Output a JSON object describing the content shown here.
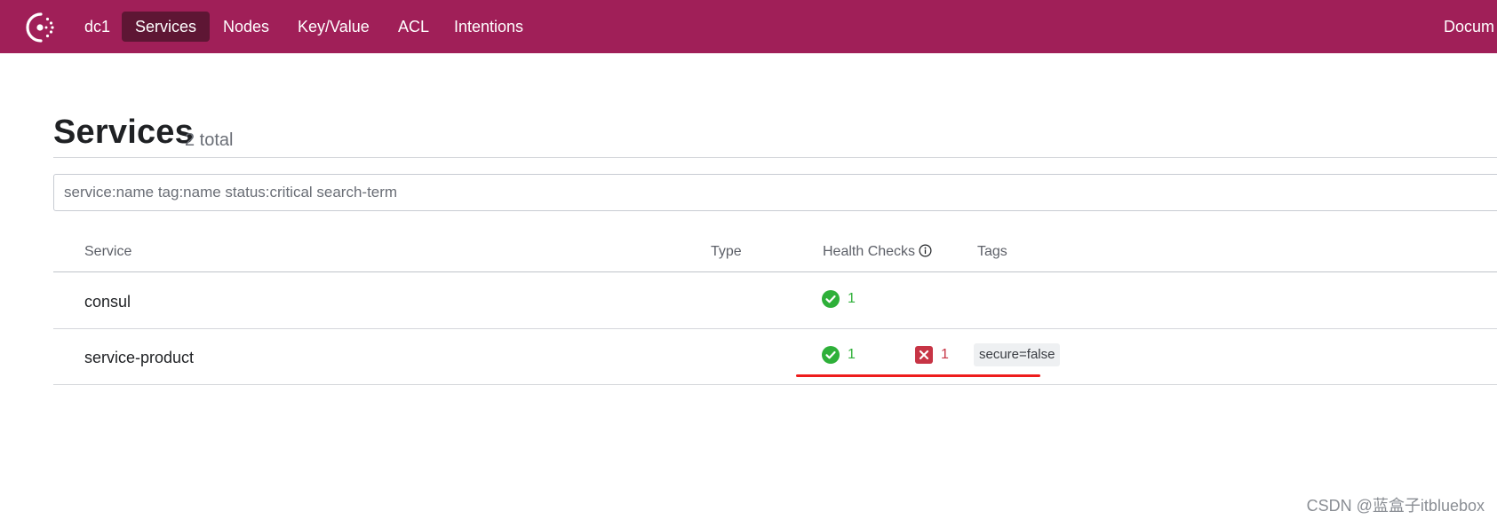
{
  "nav": {
    "datacenter": "dc1",
    "items": [
      {
        "label": "Services",
        "active": true
      },
      {
        "label": "Nodes",
        "active": false
      },
      {
        "label": "Key/Value",
        "active": false
      },
      {
        "label": "ACL",
        "active": false
      },
      {
        "label": "Intentions",
        "active": false
      }
    ],
    "right_link": "Docum",
    "bar_color": "#a01f58",
    "active_color": "#5e1634"
  },
  "header": {
    "title": "Services",
    "count": "2 total"
  },
  "search": {
    "placeholder": "service:name tag:name status:critical search-term",
    "value": ""
  },
  "table": {
    "columns": [
      "Service",
      "Type",
      "Health Checks",
      "Tags"
    ],
    "rows": [
      {
        "name": "consul",
        "type": "",
        "passing": "1",
        "critical": "",
        "tags": []
      },
      {
        "name": "service-product",
        "type": "",
        "passing": "1",
        "critical": "1",
        "tags": [
          "secure=false"
        ]
      }
    ]
  },
  "icons": {
    "logo": "consul-logo-icon",
    "info": "info-icon",
    "passing": "check-circle-icon",
    "critical": "x-square-icon"
  },
  "colors": {
    "passing": "#2eb039",
    "critical": "#c73445",
    "annotation": "#ee1c1c"
  },
  "watermark": "CSDN @蓝盒子itbluebox"
}
